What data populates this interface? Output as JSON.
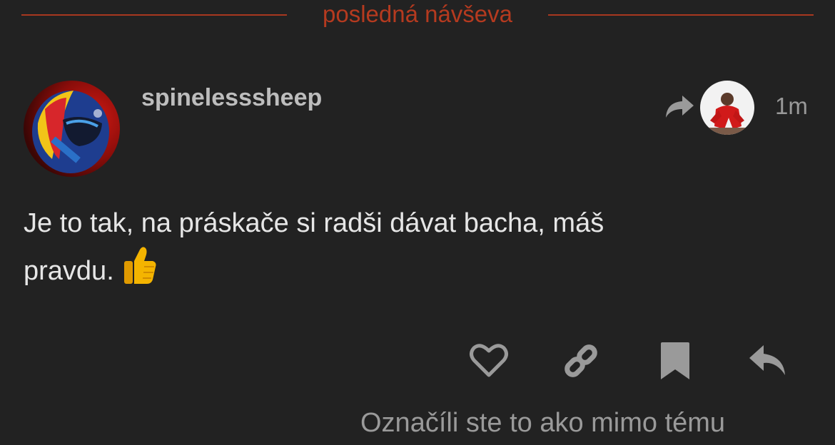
{
  "divider": {
    "label": "posledná návševa",
    "color": "#a8381f"
  },
  "post": {
    "username": "spinelesssheep",
    "time": "1m",
    "body_line1": "Je to tak, na práskače si radši dávat bacha, máš",
    "body_line2": "pravdu.",
    "emoji": "thumbs-up"
  },
  "icons": {
    "reply_to": "share-arrow-icon",
    "like": "heart-icon",
    "link": "link-icon",
    "bookmark": "bookmark-icon",
    "reply": "reply-icon"
  },
  "footer": {
    "flag_notice": "Označíli ste to ako mimo tému"
  }
}
